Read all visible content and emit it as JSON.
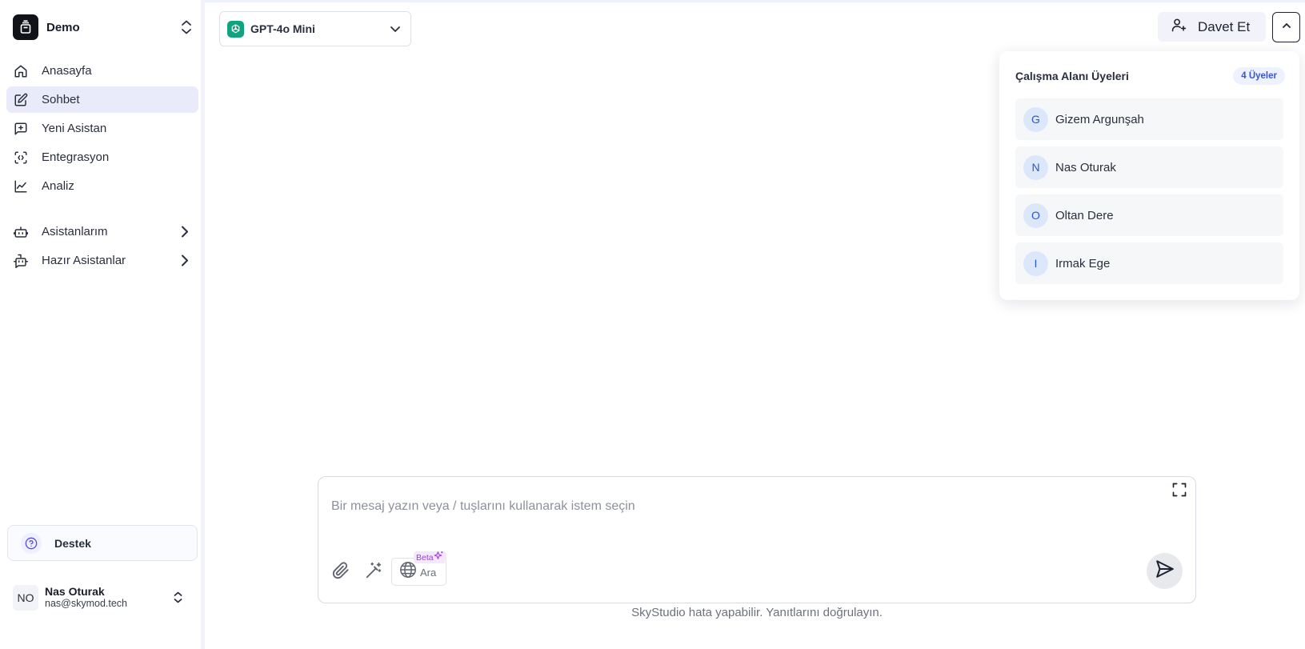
{
  "workspace": {
    "name": "Demo"
  },
  "nav": {
    "items": [
      {
        "label": "Anasayfa",
        "icon": "home-icon"
      },
      {
        "label": "Sohbet",
        "icon": "edit-icon",
        "active": true
      },
      {
        "label": "Yeni Asistan",
        "icon": "message-plus-icon"
      },
      {
        "label": "Entegrasyon",
        "icon": "code-frame-icon"
      },
      {
        "label": "Analiz",
        "icon": "line-chart-icon"
      }
    ],
    "groups": [
      {
        "label": "Asistanlarım",
        "icon": "bot-icon"
      },
      {
        "label": "Hazır Asistanlar",
        "icon": "bot-message-icon"
      }
    ]
  },
  "support": {
    "label": "Destek"
  },
  "user": {
    "initials": "NO",
    "name": "Nas Oturak",
    "email": "nas@skymod.tech"
  },
  "model": {
    "name": "GPT-4o Mini"
  },
  "header": {
    "invite_label": "Davet Et"
  },
  "members_panel": {
    "title": "Çalışma Alanı Üyeleri",
    "count_badge": "4 Üyeler",
    "members": [
      {
        "initial": "G",
        "name": "Gizem Argunşah"
      },
      {
        "initial": "N",
        "name": "Nas Oturak"
      },
      {
        "initial": "O",
        "name": "Oltan Dere"
      },
      {
        "initial": "I",
        "name": "Irmak Ege"
      }
    ]
  },
  "composer": {
    "placeholder": "Bir mesaj yazın veya / tuşlarını kullanarak istem seçin",
    "search_label": "Ara",
    "beta_label": "Beta",
    "disclaimer": "SkyStudio hata yapabilir. Yanıtlarını doğrulayın."
  },
  "colors": {
    "accent": "#3754d6",
    "active_nav": "#e9ebfb",
    "model_brand": "#10a37f",
    "beta": "#9b3fd8"
  }
}
